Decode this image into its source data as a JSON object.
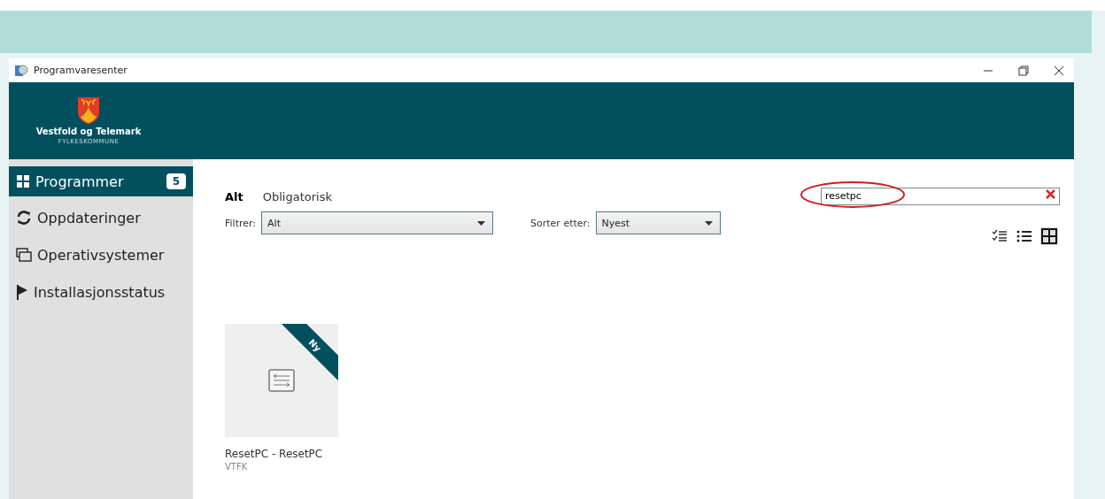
{
  "window": {
    "title": "Programvaresenter"
  },
  "brand": {
    "name": "Vestfold og Telemark",
    "subtitle": "FYLKESKOMMUNE"
  },
  "sidebar": {
    "items": [
      {
        "kind": "grid",
        "label": "Programmer",
        "badge": "5",
        "selected": true
      },
      {
        "kind": "refresh",
        "label": "Oppdateringer",
        "selected": false
      },
      {
        "kind": "windows",
        "label": "Operativsystemer",
        "selected": false
      },
      {
        "kind": "flag",
        "label": "Installasjonsstatus",
        "selected": false
      }
    ]
  },
  "tabs": [
    {
      "label": "Alt",
      "selected": true
    },
    {
      "label": "Obligatorisk",
      "selected": false
    }
  ],
  "filter": {
    "label": "Filtrer:",
    "value": "Alt"
  },
  "sort": {
    "label": "Sorter etter:",
    "value": "Nyest"
  },
  "search": {
    "value": "resetpc"
  },
  "views": [
    {
      "kind": "checklist",
      "selected": false
    },
    {
      "kind": "list",
      "selected": false
    },
    {
      "kind": "tiles",
      "selected": true
    }
  ],
  "apps": [
    {
      "name": "ResetPC - ResetPC",
      "publisher": "VTFK",
      "ribbon": "Ny"
    }
  ]
}
